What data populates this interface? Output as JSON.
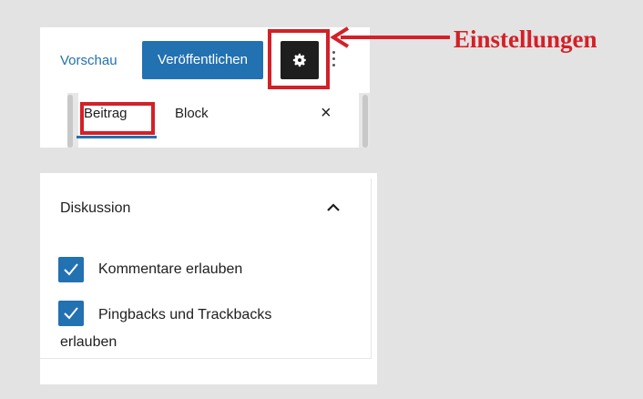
{
  "toolbar": {
    "preview_label": "Vorschau",
    "publish_label": "Veröffentlichen",
    "settings_icon": "gear-icon",
    "more_icon": "vertical-ellipsis-icon"
  },
  "tabs": {
    "post_label": "Beitrag",
    "block_label": "Block",
    "close_symbol": "×"
  },
  "callout": {
    "label": "Einstellungen",
    "color": "#d42027"
  },
  "discussion": {
    "title": "Diskussion",
    "collapse_icon": "chevron-up-icon",
    "options": [
      {
        "label": "Kommentare erlauben",
        "checked": true
      },
      {
        "label_line1": "Pingbacks und Trackbacks",
        "label_line2": "erlauben",
        "checked": true
      }
    ]
  },
  "colors": {
    "accent": "#2271b1",
    "settings_button": "#1e1e1e",
    "highlight": "#d42027",
    "background": "#e3e3e3"
  }
}
